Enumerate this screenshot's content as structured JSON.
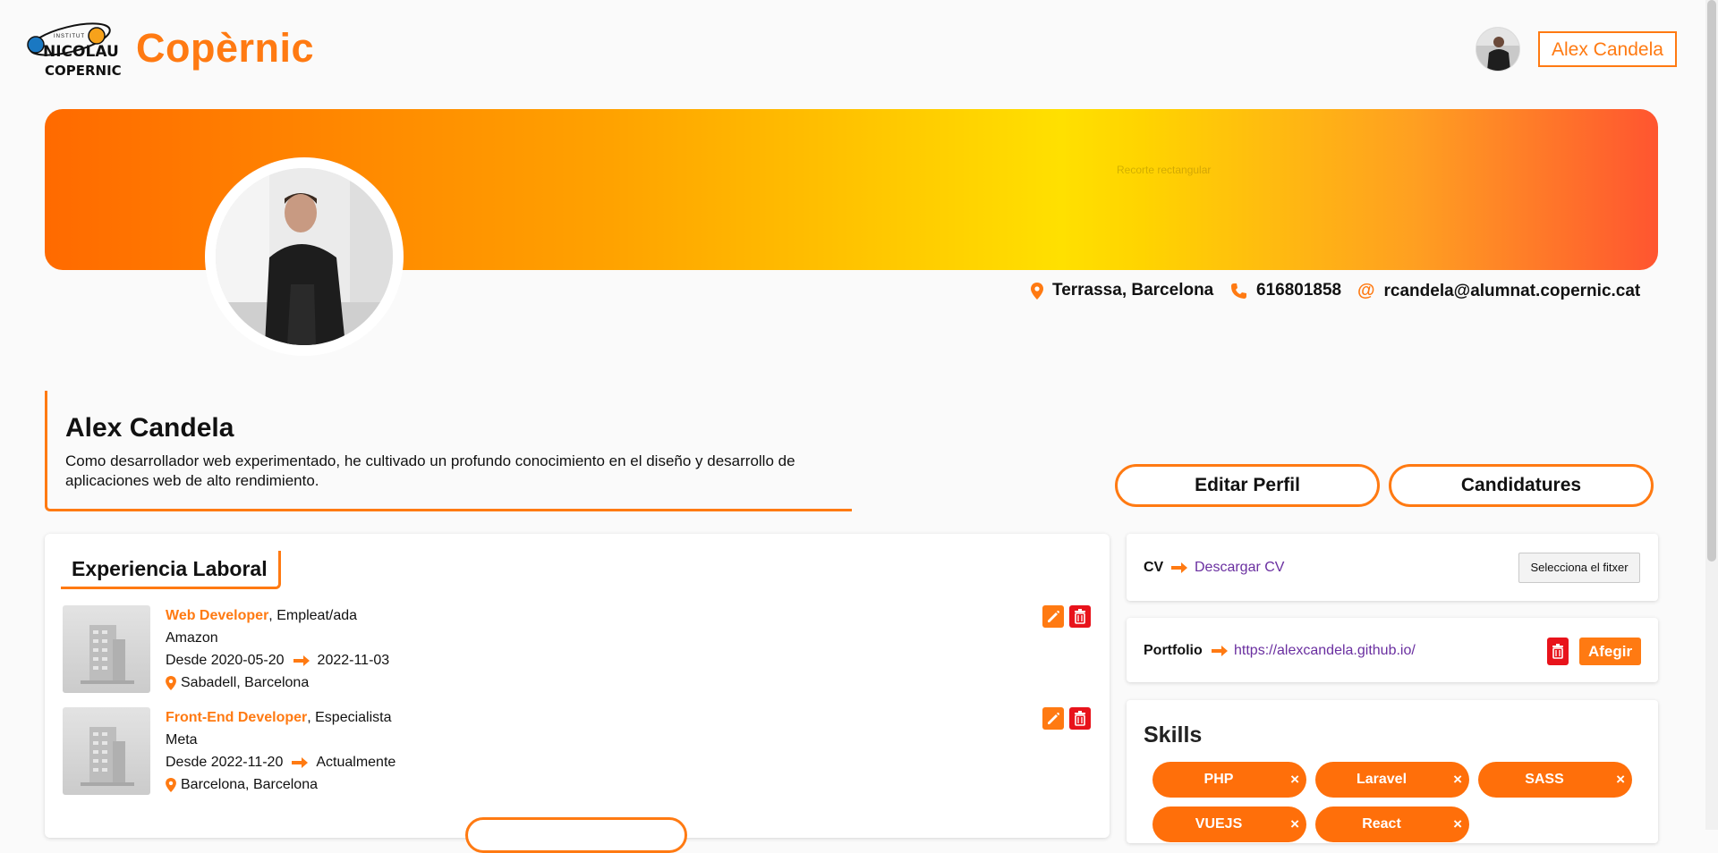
{
  "header": {
    "logo_text_top": "INSTITUT",
    "logo_text_1": "NICOLAU",
    "logo_text_2": "COPERNIC",
    "brand": "Copèrnic",
    "user_name": "Alex Candela"
  },
  "banner": {
    "overlay_text": "Recorte rectangular"
  },
  "contact": {
    "location": "Terrassa, Barcelona",
    "phone": "616801858",
    "email": "rcandela@alumnat.copernic.cat"
  },
  "profile": {
    "name": "Alex Candela",
    "bio": "Como desarrollador web experimentado, he cultivado un profundo conocimiento en el diseño y desarrollo de aplicaciones web de alto rendimiento.",
    "edit_button": "Editar Perfil",
    "applications_button": "Candidatures"
  },
  "experience": {
    "title": "Experiencia Laboral",
    "items": [
      {
        "role": "Web Developer",
        "type": ", Empleat/ada",
        "company": "Amazon",
        "from": "Desde 2020-05-20",
        "to": "2022-11-03",
        "location": "Sabadell, Barcelona"
      },
      {
        "role": "Front-End Developer",
        "type": ", Especialista",
        "company": "Meta",
        "from": "Desde 2022-11-20",
        "to": "Actualmente",
        "location": "Barcelona, Barcelona"
      }
    ]
  },
  "cv": {
    "label": "CV",
    "link": "Descargar CV",
    "file_button": "Selecciona el fitxer"
  },
  "portfolio": {
    "label": "Portfolio",
    "link": "https://alexcandela.github.io/",
    "add_button": "Afegir"
  },
  "skills": {
    "title": "Skills",
    "items": [
      "PHP",
      "Laravel",
      "SASS",
      "VUEJS",
      "React"
    ],
    "remove_glyph": "×"
  },
  "colors": {
    "accent": "#ff7a12",
    "danger": "#e8131b",
    "link": "#6a2fa0"
  },
  "icons": {
    "location": "map-pin-icon",
    "phone": "phone-icon",
    "email": "at-icon",
    "arrow": "arrow-right-icon",
    "edit": "pencil-icon",
    "delete": "trash-icon",
    "remove": "close-icon"
  }
}
